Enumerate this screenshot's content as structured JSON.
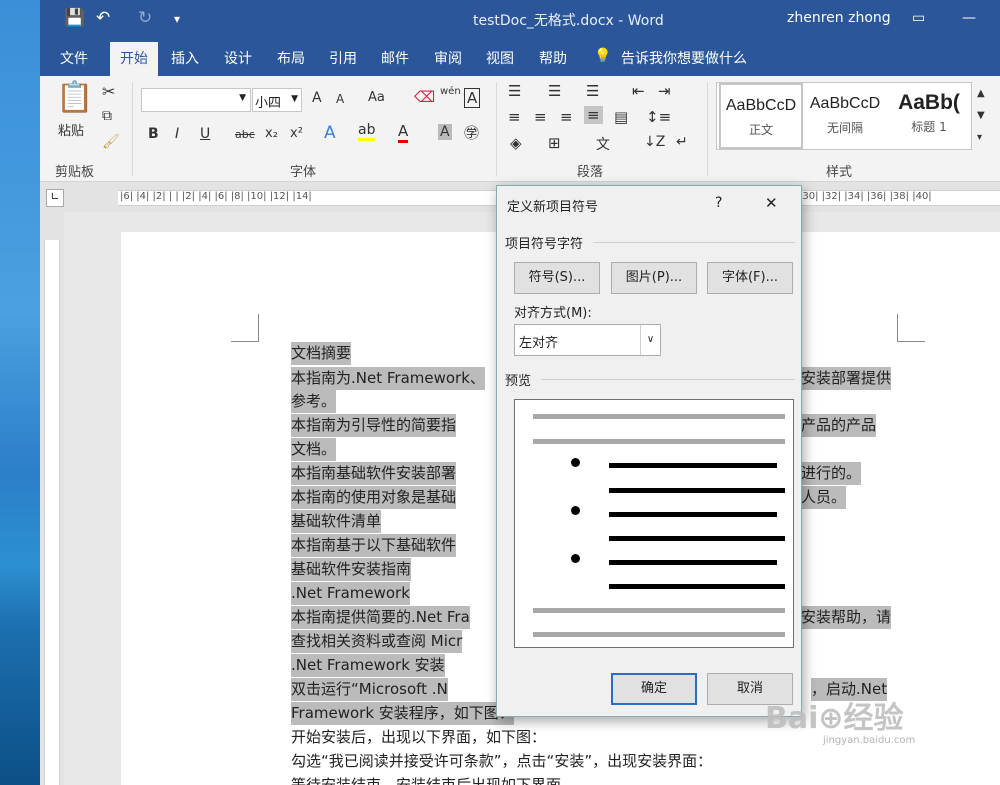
{
  "window": {
    "doc_title": "testDoc_无格式.docx - Word",
    "user": "zhenren zhong"
  },
  "quick_access": {
    "save": "💾",
    "undo": "↶",
    "redo": "↻",
    "customize": "▾"
  },
  "tabs": [
    "文件",
    "开始",
    "插入",
    "设计",
    "布局",
    "引用",
    "邮件",
    "审阅",
    "视图",
    "帮助"
  ],
  "tell_me": "告诉我你想要做什么",
  "ribbon": {
    "clipboard": {
      "label": "剪贴板",
      "paste": "粘贴"
    },
    "font": {
      "label": "字体",
      "size": "小四",
      "bold": "B",
      "italic": "I",
      "underline": "U",
      "strike": "abc",
      "sub": "x₂",
      "sup": "x²",
      "grow": "A",
      "shrink": "A",
      "case": "Aa",
      "phonetic": "wén"
    },
    "paragraph": {
      "label": "段落"
    },
    "styles": {
      "label": "样式",
      "items": [
        {
          "sample": "AaBbCcD",
          "name": "正文"
        },
        {
          "sample": "AaBbCcD",
          "name": "无间隔"
        },
        {
          "sample": "AaBb(",
          "name": "标题 1"
        }
      ]
    }
  },
  "ruler": {
    "text": "|6| |4| |2| | | |2| |4| |6| |8| |10| |12| |14|",
    "right": "|30| |32| |34| |36| |38| |40|"
  },
  "document": {
    "lines": [
      "文档摘要",
      "本指南为.Net Framework、",
      "安装部署提供",
      "参考。",
      "本指南为引导性的简要指",
      "产品的产品",
      "文档。",
      "本指南基础软件安装部署",
      "进行的。",
      "本指南的使用对象是基础",
      "人员。",
      "基础软件清单",
      "本指南基于以下基础软件",
      "基础软件安装指南",
      ".Net Framework",
      "本指南提供简要的.Net Fra",
      "安装帮助，请",
      "查找相关资料或查阅 Micr",
      ".Net Framework 安装",
      "双击运行“Microsoft .N",
      "，启动.Net",
      "Framework 安装程序，如下图：",
      "开始安装后，出现以下界面，如下图：",
      "勾选“我已阅读并接受许可条款”，点击“安装”，出现安装界面：",
      "等待安装结束，安装结束后出现如下界面"
    ]
  },
  "dialog": {
    "title": "定义新项目符号",
    "help": "?",
    "close": "✕",
    "section_char": "项目符号字符",
    "btn_symbol": "符号(S)...",
    "btn_picture": "图片(P)...",
    "btn_font": "字体(F)...",
    "align_label": "对齐方式(M):",
    "align_value": "左对齐",
    "preview_label": "预览",
    "ok": "确定",
    "cancel": "取消"
  },
  "watermark": {
    "brand": "Bai⊕经验",
    "url": "jingyan.baidu.com"
  }
}
